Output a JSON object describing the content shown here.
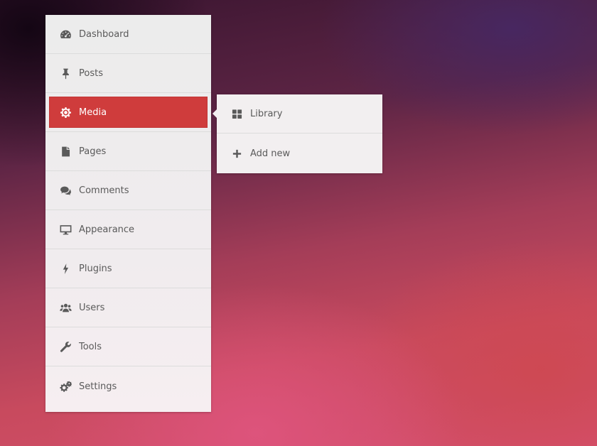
{
  "menu": {
    "items": [
      {
        "label": "Dashboard",
        "icon": "dashboard-icon"
      },
      {
        "label": "Posts",
        "icon": "pin-icon"
      },
      {
        "label": "Media",
        "icon": "gear-icon",
        "active": true
      },
      {
        "label": "Pages",
        "icon": "file-icon"
      },
      {
        "label": "Comments",
        "icon": "comments-icon"
      },
      {
        "label": "Appearance",
        "icon": "monitor-icon"
      },
      {
        "label": "Plugins",
        "icon": "bolt-icon"
      },
      {
        "label": "Users",
        "icon": "users-icon"
      },
      {
        "label": "Tools",
        "icon": "wrench-icon"
      },
      {
        "label": "Settings",
        "icon": "cogs-icon"
      }
    ]
  },
  "submenu": {
    "items": [
      {
        "label": "Library",
        "icon": "grid-icon"
      },
      {
        "label": "Add new",
        "icon": "plus-icon"
      }
    ]
  },
  "colors": {
    "active": "#cf3c3c",
    "menu_bg": "#ececec",
    "text": "#5a5a5a"
  }
}
